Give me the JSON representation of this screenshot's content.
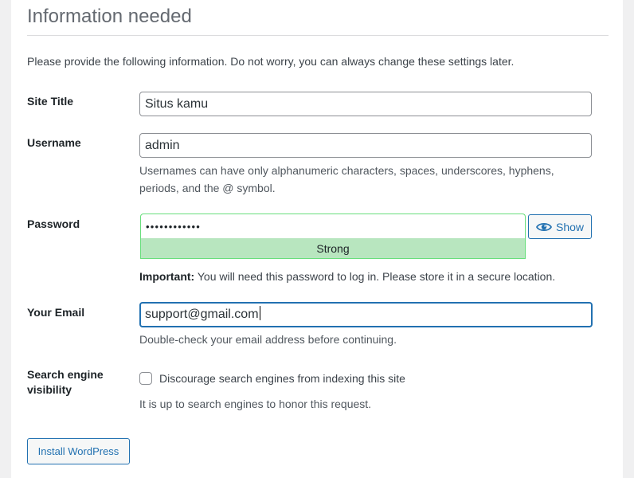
{
  "header": {
    "title": "Information needed"
  },
  "intro": "Please provide the following information. Do not worry, you can always change these settings later.",
  "form": {
    "site_title": {
      "label": "Site Title",
      "value": "Situs kamu"
    },
    "username": {
      "label": "Username",
      "value": "admin",
      "help": "Usernames can have only alphanumeric characters, spaces, underscores, hyphens, periods, and the @ symbol."
    },
    "password": {
      "label": "Password",
      "masked_value": "••••••••••••",
      "strength": "Strong",
      "show_label": "Show",
      "important_label": "Important:",
      "important_text": " You will need this password to log in. Please store it in a secure location."
    },
    "email": {
      "label": "Your Email",
      "value": "support@gmail.com",
      "help": "Double-check your email address before continuing."
    },
    "search_visibility": {
      "label": "Search engine visibility",
      "checkbox_label": "Discourage search engines from indexing this site",
      "checked": false,
      "help": "It is up to search engines to honor this request."
    }
  },
  "actions": {
    "install_label": "Install WordPress"
  },
  "colors": {
    "accent": "#2271b1",
    "strength_bg": "#b8e6bf",
    "strength_border": "#68de7c"
  },
  "icons": {
    "show_password": "eye-icon"
  }
}
